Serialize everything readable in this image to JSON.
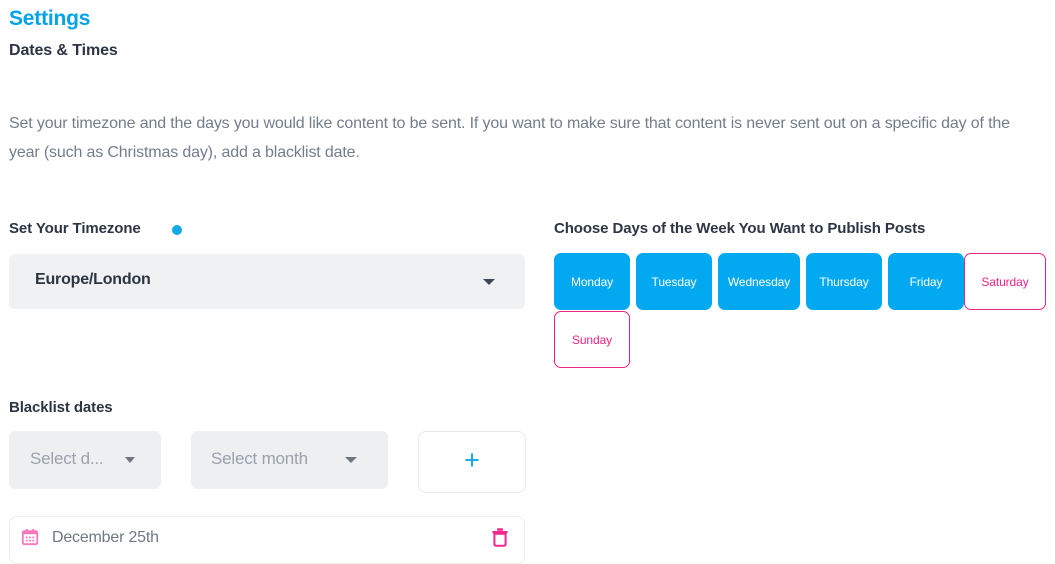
{
  "header": {
    "title": "Settings",
    "subtitle": "Dates & Times",
    "intro": "Set your timezone and the days you would like content to be sent. If you want to make sure that content is never sent out on a specific day of the year (such as Christmas day), add a blacklist date."
  },
  "timezone": {
    "label": "Set Your Timezone",
    "value": "Europe/London",
    "dot_color": "#11a8e8"
  },
  "days": {
    "label": "Choose Days of the Week You Want to Publish Posts",
    "selected_color": "#03a9f0",
    "unselected_color": "#ec2387",
    "items": [
      {
        "label": "Monday",
        "selected": true
      },
      {
        "label": "Tuesday",
        "selected": true
      },
      {
        "label": "Wednesday",
        "selected": true
      },
      {
        "label": "Thursday",
        "selected": true
      },
      {
        "label": "Friday",
        "selected": true
      },
      {
        "label": "Saturday",
        "selected": false
      },
      {
        "label": "Sunday",
        "selected": false
      }
    ]
  },
  "blacklist": {
    "label": "Blacklist dates",
    "day_placeholder": "Select d...",
    "month_placeholder": "Select month",
    "add_label": "+",
    "entries": [
      {
        "text": "December 25th",
        "calendar_icon": "calendar-icon",
        "delete_icon": "trash-icon"
      }
    ]
  }
}
